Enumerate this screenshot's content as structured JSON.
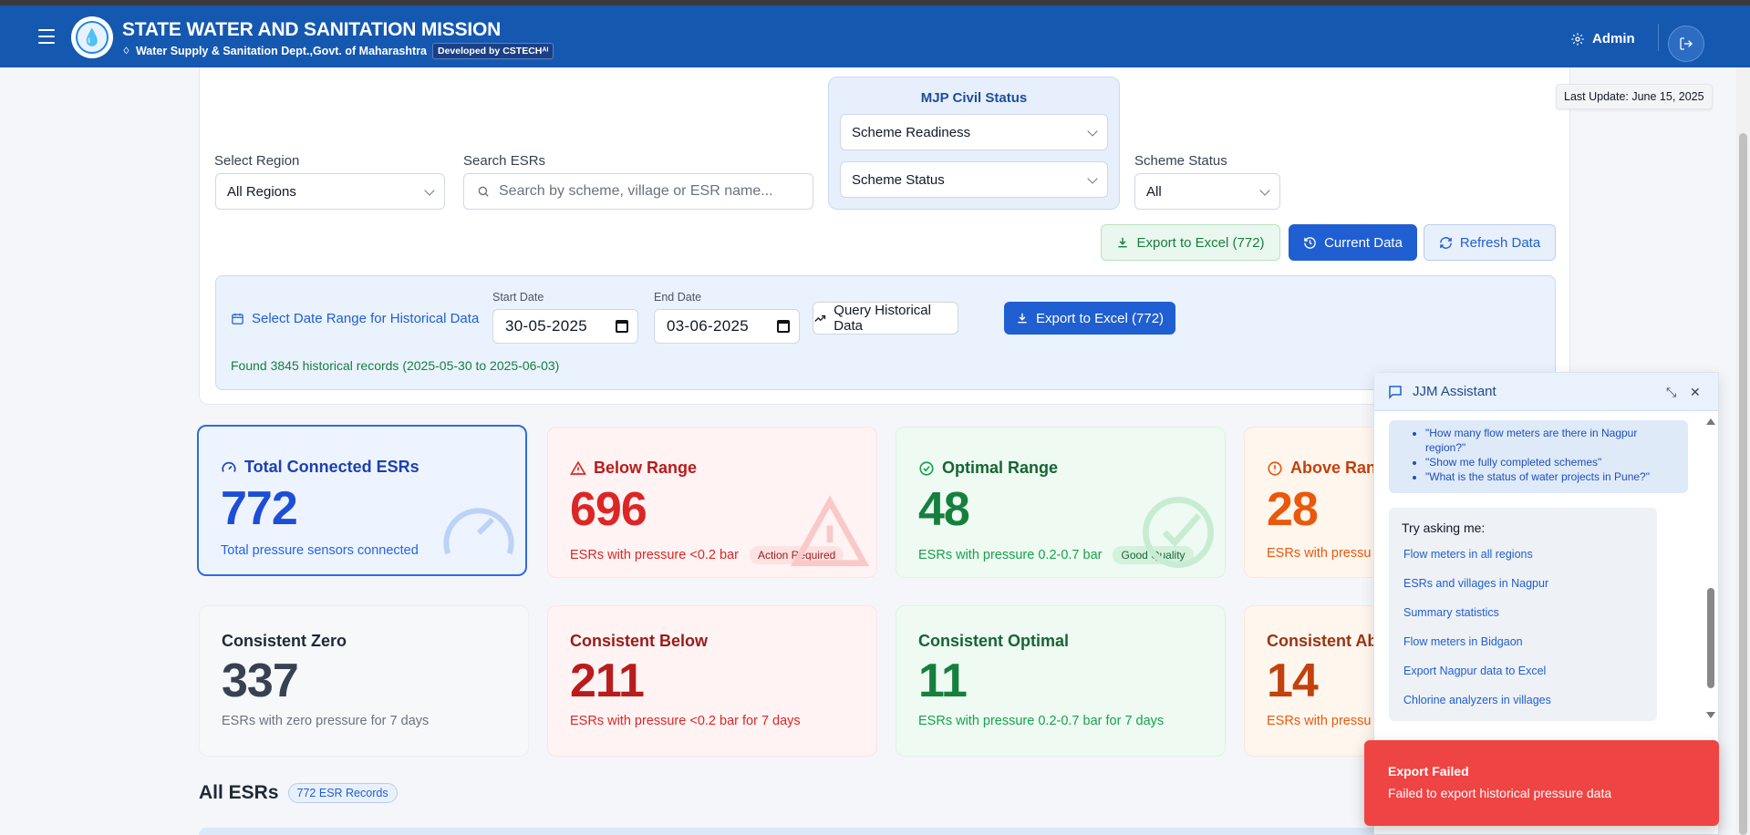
{
  "header": {
    "title": "STATE WATER AND SANITATION MISSION",
    "subtitle": "Water Supply & Sanitation Dept.,Govt. of Maharashtra",
    "developed_by": "Developed by CSTECHᴬᴵ",
    "user": "Admin"
  },
  "last_update": "Last Update: June 15, 2025",
  "filters": {
    "region_label": "Select Region",
    "region_value": "All Regions",
    "search_label": "Search ESRs",
    "search_placeholder": "Search by scheme, village or ESR name...",
    "mjp_title": "MJP Civil Status",
    "scheme_readiness": "Scheme Readiness",
    "scheme_status_select": "Scheme Status",
    "scheme_status_label": "Scheme Status",
    "scheme_status_value": "All"
  },
  "actions": {
    "export_excel": "Export to Excel (772)",
    "current_data": "Current Data",
    "refresh_data": "Refresh Data"
  },
  "historical": {
    "title": "Select Date Range for Historical Data",
    "start_label": "Start Date",
    "start_value": "30-05-2025",
    "end_label": "End Date",
    "end_value": "03-06-2025",
    "query_button": "Query Historical Data",
    "export_button": "Export to Excel (772)",
    "found_text": "Found 3845 historical records (2025-05-30 to 2025-06-03)"
  },
  "stats": [
    {
      "title": "Total Connected ESRs",
      "value": "772",
      "desc": "Total pressure sensors connected",
      "badge": ""
    },
    {
      "title": "Below Range",
      "value": "696",
      "desc": "ESRs with pressure <0.2 bar",
      "badge": "Action Required"
    },
    {
      "title": "Optimal Range",
      "value": "48",
      "desc": "ESRs with pressure 0.2-0.7 bar",
      "badge": "Good Quality"
    },
    {
      "title": "Above Ran",
      "value": "28",
      "desc": "ESRs with pressu",
      "badge": ""
    }
  ],
  "consistent": [
    {
      "title": "Consistent Zero",
      "value": "337",
      "desc": "ESRs with zero pressure for 7 days"
    },
    {
      "title": "Consistent Below",
      "value": "211",
      "desc": "ESRs with pressure <0.2 bar for 7 days"
    },
    {
      "title": "Consistent Optimal",
      "value": "11",
      "desc": "ESRs with pressure 0.2-0.7 bar for 7 days"
    },
    {
      "title": "Consistent Ab",
      "value": "14",
      "desc": "ESRs with pressu"
    }
  ],
  "all_esrs": {
    "title": "All ESRs",
    "badge": "772 ESR Records"
  },
  "chat": {
    "title": "JJM Assistant",
    "examples": [
      "\"How many flow meters are there in Nagpur region?\"",
      "\"Show me fully completed schemes\"",
      "\"What is the status of water projects in Pune?\""
    ],
    "try_title": "Try asking me:",
    "suggestions": [
      "Flow meters in all regions",
      "ESRs and villages in Nagpur",
      "Summary statistics",
      "Flow meters in Bidgaon",
      "Export Nagpur data to Excel",
      "Chlorine analyzers in villages"
    ]
  },
  "toast": {
    "title": "Export Failed",
    "message": "Failed to export historical pressure data"
  },
  "colors": {
    "header": "#1558b0",
    "primary": "#1f5fd1",
    "danger": "#dc2626",
    "success": "#15803d",
    "warning": "#ea580c",
    "toast": "#ef4444"
  }
}
